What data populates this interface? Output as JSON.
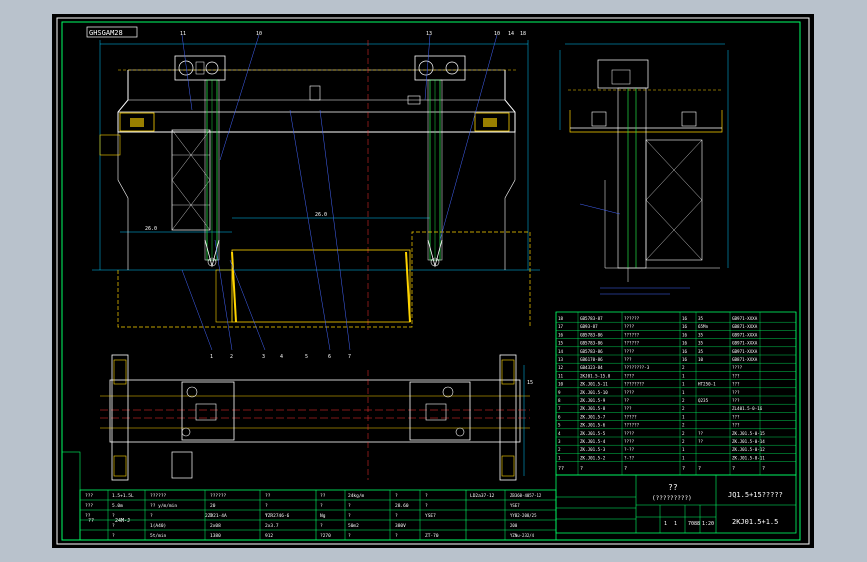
{
  "colors": {
    "background": "#000000",
    "frame": "#ffffff",
    "title_block": "#00ff66",
    "structure": "#ffffff",
    "rails": "#ffd400",
    "dimensions": "#00c8ff",
    "hoist_tube": "#22dd44",
    "leaders": "#4466ff",
    "centerline": "#ff3333"
  },
  "view_label": "GHSGAM28",
  "balloons_top": [
    "11",
    "10",
    "13",
    "10",
    "14",
    "18"
  ],
  "balloons_mid": [
    "1",
    "2",
    "3",
    "4",
    "5",
    "6",
    "7",
    "8",
    "9"
  ],
  "parts_rows": [
    {
      "no": "18",
      "code": "GB5783-87",
      "name": "??????",
      "qty": "16",
      "mat": "35",
      "mass": "GB971-XXXA"
    },
    {
      "no": "17",
      "code": "GB93-87",
      "name": "????",
      "qty": "16",
      "mat": "65Mn",
      "mass": "GB871-XXXA"
    },
    {
      "no": "16",
      "code": "GB5783-86",
      "name": "??????",
      "qty": "16",
      "mat": "35",
      "mass": "GB971-XXXA"
    },
    {
      "no": "15",
      "code": "GB5783-86",
      "name": "??????",
      "qty": "16",
      "mat": "35",
      "mass": "GB971-XXXA"
    },
    {
      "no": "14",
      "code": "GB5783-86",
      "name": "????",
      "qty": "16",
      "mat": "35",
      "mass": "GB971-XXXA"
    },
    {
      "no": "13",
      "code": "GB6170-86",
      "name": "???",
      "qty": "16",
      "mat": "10",
      "mass": "GB871-XXXA"
    },
    {
      "no": "12",
      "code": "GB4323-84",
      "name": "????????-3",
      "qty": "2",
      "mat": "",
      "mass": "????"
    }
  ],
  "parts_rows2": [
    {
      "no": "11",
      "code": "2KJ01.5-15.0",
      "name": "????",
      "qty": "1",
      "mat": "",
      "mass": "???"
    },
    {
      "no": "10",
      "code": "ZK.J01.5-11",
      "name": "????????",
      "qty": "1",
      "mat": "HT250-1",
      "mass": "???"
    },
    {
      "no": "9",
      "code": "ZK.J01.5-10",
      "name": "????",
      "qty": "1",
      "mat": "",
      "mass": "???"
    },
    {
      "no": "8",
      "code": "ZK.J01.5-9",
      "name": "??",
      "qty": "2",
      "mat": "Q235",
      "mass": "???"
    },
    {
      "no": "7",
      "code": "ZK.J01.5-8",
      "name": "???",
      "qty": "2",
      "mat": "",
      "mass": "ZL401.5-0-16"
    },
    {
      "no": "6",
      "code": "ZK.J01.5-7",
      "name": "?????",
      "qty": "1",
      "mat": "",
      "mass": "???"
    },
    {
      "no": "5",
      "code": "ZK.J01.5-6",
      "name": "??????",
      "qty": "2",
      "mat": "",
      "mass": "???"
    },
    {
      "no": "4",
      "code": "ZK.J01.5-5",
      "name": "????",
      "qty": "2",
      "mat": "??",
      "mass": "ZK.J01.5-0-15"
    },
    {
      "no": "3",
      "code": "ZK.J01.5-4",
      "name": "????",
      "qty": "2",
      "mat": "??",
      "mass": "ZK.J01.5-0-14"
    },
    {
      "no": "2",
      "code": "ZK.J01.5-3",
      "name": "?-??",
      "qty": "1",
      "mat": "",
      "mass": "ZK.J01.5-0-12"
    },
    {
      "no": "1",
      "code": "ZK.J01.5-2",
      "name": "?-??",
      "qty": "1",
      "mat": "",
      "mass": "ZK.J01.5-0-11"
    }
  ],
  "parts_header": [
    "??",
    "?",
    "?",
    "?",
    "?",
    "?",
    "?"
  ],
  "title_block": {
    "title": "??",
    "subtitle": "(?????????)",
    "drawing_name": "JQ1.5+15?????",
    "drawing_no": "2KJ01.5+1.5",
    "sheet": "1:20",
    "scale": "1",
    "weight": "7088",
    "mark_left": "1",
    "mark_right": "1"
  },
  "spec_block": {
    "r1": [
      "???",
      "1.5+1.5L",
      "??????",
      "??????",
      "??"
    ],
    "r2": [
      "???",
      "5.0m",
      "?? y/m/min",
      "20",
      "?"
    ],
    "r3": [
      "??",
      "?",
      "?",
      "?",
      "?"
    ],
    "r4": [
      "2ZD21-4A",
      "YZR2746-6"
    ],
    "r5": [
      "?",
      "1(A40)",
      "2x08",
      "2x3.7"
    ],
    "r6": [
      "?",
      "5t/min",
      "1380",
      "912"
    ],
    "mid_a": [
      "??",
      "24kg/m",
      "?",
      "?",
      "LD2a37-12"
    ],
    "mid_b": [
      "?",
      "?",
      "28.60",
      "?"
    ],
    "mid_c": [
      "Ng",
      "?",
      "?",
      "YSE7"
    ],
    "mid_d": [
      "?",
      "50m2",
      "380V"
    ],
    "mid_e": [
      "?270",
      "?",
      "?",
      "ZT-70"
    ],
    "right_a": [
      "ZB360-4057-12",
      "YSE7",
      "YYB2-208/25",
      "200",
      "YZNu-232/4"
    ],
    "left_code": "24M-J",
    "left_qq": "??"
  },
  "dim_labels": [
    "26.0",
    "26.0",
    "15"
  ]
}
